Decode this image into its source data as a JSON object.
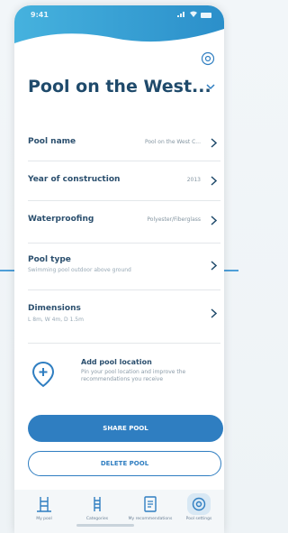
{
  "status_bar": {
    "time": "9:41"
  },
  "header": {
    "title": "Pool on the West..."
  },
  "rows": [
    {
      "label": "Pool name",
      "value": "Pool on the West C...",
      "sub": ""
    },
    {
      "label": "Year of construction",
      "value": "2013",
      "sub": ""
    },
    {
      "label": "Waterproofing",
      "value": "Polyester/Fiberglass",
      "sub": ""
    },
    {
      "label": "Pool type",
      "value": "",
      "sub": "Swimming pool outdoor above ground"
    },
    {
      "label": "Dimensions",
      "value": "",
      "sub": "L 8m, W 4m, D 1.5m"
    }
  ],
  "location": {
    "title": "Add pool location",
    "description": "Pin your pool location and improve the recommendations you receive"
  },
  "buttons": {
    "share": "SHARE POOL",
    "delete": "DELETE POOL"
  },
  "tabs": [
    {
      "label": "My pool",
      "icon": "pool-ladder-icon"
    },
    {
      "label": "Categories",
      "icon": "ladder-icon"
    },
    {
      "label": "My recommendations",
      "icon": "document-icon"
    },
    {
      "label": "Pool settings",
      "icon": "gear-icon"
    }
  ],
  "colors": {
    "accent": "#2f7ec1",
    "title": "#1f4a6b",
    "wave": "#4bb0dc"
  }
}
